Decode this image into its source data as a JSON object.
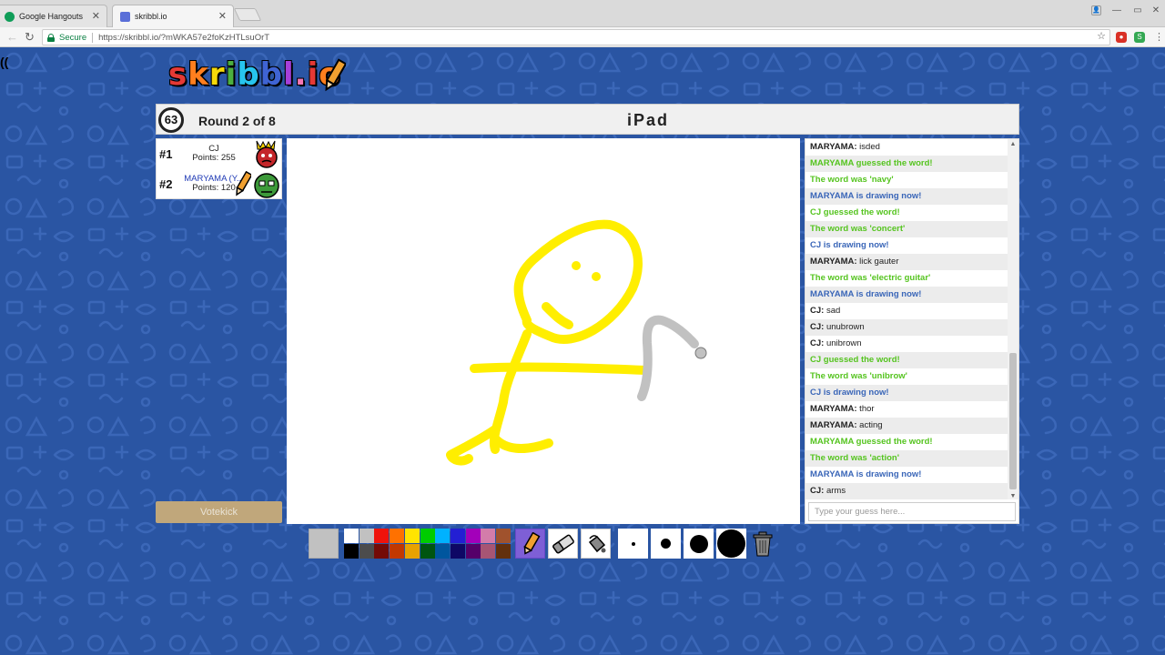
{
  "browser": {
    "tabs": [
      {
        "title": "Google Hangouts",
        "favicon_color": "#0f9d58",
        "active": false
      },
      {
        "title": "skribbl.io",
        "favicon_color": "#5a6fd8",
        "active": true
      }
    ],
    "secure_label": "Secure",
    "url": "https://skribbl.io/?mWKA57e2foKzHTLsuOrT"
  },
  "logo": {
    "letters": [
      "s",
      "k",
      "r",
      "i",
      "b",
      "b",
      "l",
      ".",
      "i",
      "o"
    ],
    "colors": [
      "#e53935",
      "#ff7f1e",
      "#f5d90a",
      "#4caf3f",
      "#27c4ee",
      "#3f64d3",
      "#a63fd9",
      "#f576b4",
      "#e53935",
      "#ff7f1e"
    ]
  },
  "header": {
    "timer": "63",
    "round": "Round 2 of 8",
    "word": "iPad"
  },
  "players": [
    {
      "rank": "#1",
      "name": "CJ",
      "score": "Points: 255",
      "name_color": "#222222",
      "avatar": "red-devil-avatar"
    },
    {
      "rank": "#2",
      "name": "MARYAMA (Y...",
      "score": "Points: 120",
      "name_color": "#1f3ab5",
      "avatar": "green-avatar"
    }
  ],
  "votekick_label": "Votekick",
  "chat": {
    "messages": [
      {
        "type": "chat",
        "sender": "MARYAMA:",
        "text": " isded"
      },
      {
        "type": "guess",
        "text": "MARYAMA guessed the word!"
      },
      {
        "type": "reveal",
        "text": "The word was 'navy'"
      },
      {
        "type": "draw",
        "text": "MARYAMA is drawing now!"
      },
      {
        "type": "guess",
        "text": "CJ guessed the word!"
      },
      {
        "type": "reveal",
        "text": "The word was 'concert'"
      },
      {
        "type": "draw",
        "text": "CJ is drawing now!"
      },
      {
        "type": "chat",
        "sender": "MARYAMA:",
        "text": " lick gauter"
      },
      {
        "type": "reveal",
        "text": "The word was 'electric guitar'"
      },
      {
        "type": "draw",
        "text": "MARYAMA is drawing now!"
      },
      {
        "type": "chat",
        "sender": "CJ:",
        "text": " sad"
      },
      {
        "type": "chat",
        "sender": "CJ:",
        "text": " unubrown"
      },
      {
        "type": "chat",
        "sender": "CJ:",
        "text": " unibrown"
      },
      {
        "type": "guess",
        "text": "CJ guessed the word!"
      },
      {
        "type": "reveal",
        "text": "The word was 'unibrow'"
      },
      {
        "type": "draw",
        "text": "CJ is drawing now!"
      },
      {
        "type": "chat",
        "sender": "MARYAMA:",
        "text": " thor"
      },
      {
        "type": "chat",
        "sender": "MARYAMA:",
        "text": " acting"
      },
      {
        "type": "guess",
        "text": "MARYAMA guessed the word!"
      },
      {
        "type": "reveal",
        "text": "The word was 'action'"
      },
      {
        "type": "draw",
        "text": "MARYAMA is drawing now!"
      },
      {
        "type": "chat",
        "sender": "CJ:",
        "text": " arms"
      }
    ],
    "input_placeholder": "Type your guess here..."
  },
  "tools": {
    "current_color": "#c1c1c1",
    "palette_top": [
      "#ffffff",
      "#c1c1c1",
      "#ef130b",
      "#ff7100",
      "#ffe400",
      "#00cc00",
      "#00b2ff",
      "#231fd3",
      "#a300ba",
      "#d37caa",
      "#a0522d"
    ],
    "palette_bottom": [
      "#000000",
      "#4c4c4c",
      "#740b07",
      "#c23800",
      "#e8a200",
      "#005510",
      "#00569e",
      "#0e0865",
      "#550069",
      "#a75574",
      "#63300d"
    ],
    "selected_tool": "pencil",
    "brush_sizes": [
      "small",
      "medium",
      "large",
      "xlarge"
    ]
  },
  "colors": {
    "page_bg": "#2a55a3",
    "stroke_yellow": "#ffee00",
    "stroke_gray": "#c1c1c1"
  }
}
